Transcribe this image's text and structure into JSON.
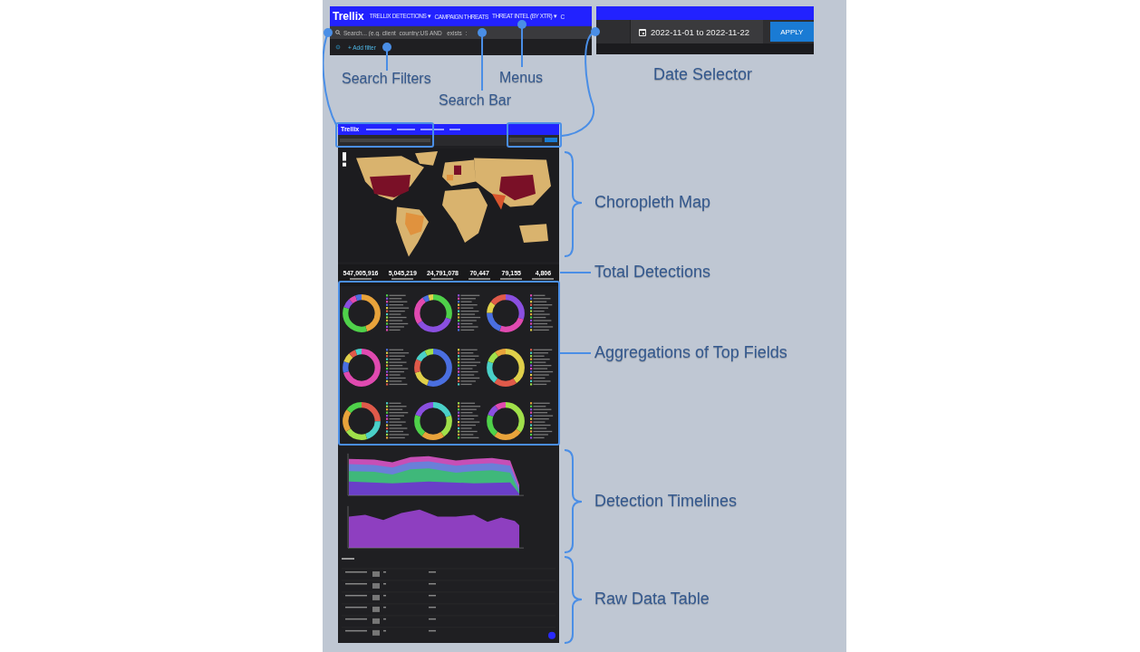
{
  "top_left_crop": {
    "logo": "Trellix",
    "menus": [
      {
        "label": "TRELLIX DETECTIONS ▾"
      },
      {
        "label": "CAMPAIGN THREATS"
      },
      {
        "label": "THREAT INTEL (BY XTR) ▾"
      },
      {
        "label": "C"
      }
    ],
    "search": {
      "placeholder": "Search... (e.g. client_country:US AND _exists_:"
    },
    "add_filter": "+ Add filter"
  },
  "date_crop": {
    "date_range": "2022-11-01 to 2022-11-22",
    "apply": "APPLY"
  },
  "callouts": [
    {
      "label": "Search Filters"
    },
    {
      "label": "Search Bar"
    },
    {
      "label": "Menus"
    },
    {
      "label": "Date Selector"
    }
  ],
  "mini_dashboard": {
    "logo": "Trellix",
    "stats": [
      "547,005,916",
      "5,045,219",
      "24,791,078",
      "70,447",
      "79,155",
      "4,806"
    ]
  },
  "section_labels": [
    {
      "label": "Choropleth Map"
    },
    {
      "label": "Total Detections"
    },
    {
      "label": "Aggregations of Top Fields"
    },
    {
      "label": "Detection Timelines"
    },
    {
      "label": "Raw Data Table"
    }
  ]
}
